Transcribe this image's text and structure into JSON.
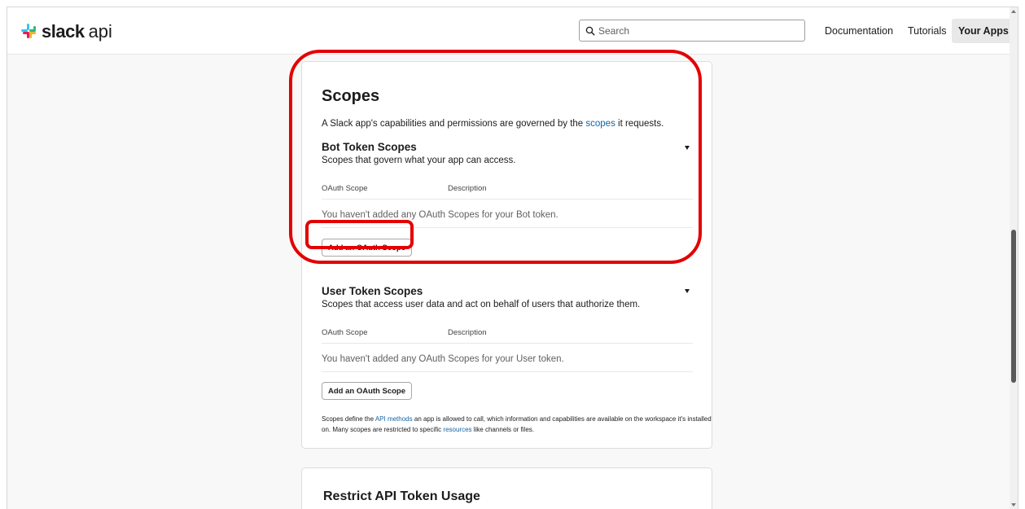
{
  "header": {
    "logo_slack": "slack",
    "logo_api": "api",
    "search_placeholder": "Search",
    "nav": {
      "documentation": "Documentation",
      "tutorials": "Tutorials",
      "your_apps": "Your Apps"
    }
  },
  "scopes": {
    "title": "Scopes",
    "intro_prefix": "A Slack app's capabilities and permissions are governed by the ",
    "intro_link": "scopes",
    "intro_suffix": " it requests.",
    "bot": {
      "title": "Bot Token Scopes",
      "subtitle": "Scopes that govern what your app can access.",
      "col_scope": "OAuth Scope",
      "col_description": "Description",
      "empty": "You haven't added any OAuth Scopes for your Bot token.",
      "add_button": "Add an OAuth Scope"
    },
    "user": {
      "title": "User Token Scopes",
      "subtitle": "Scopes that access user data and act on behalf of users that authorize them.",
      "col_scope": "OAuth Scope",
      "col_description": "Description",
      "empty": "You haven't added any OAuth Scopes for your User token.",
      "add_button": "Add an OAuth Scope"
    },
    "footer": {
      "part1": "Scopes define the ",
      "link1": "API methods",
      "part2": " an app is allowed to call, which information and capabilities are available on the workspace it's installed on. Many scopes are restricted to specific ",
      "link2": "resources",
      "part3": " like channels or files."
    }
  },
  "restrict": {
    "title": "Restrict API Token Usage"
  },
  "colors": {
    "link": "#1264a3",
    "highlight": "#e30000"
  }
}
